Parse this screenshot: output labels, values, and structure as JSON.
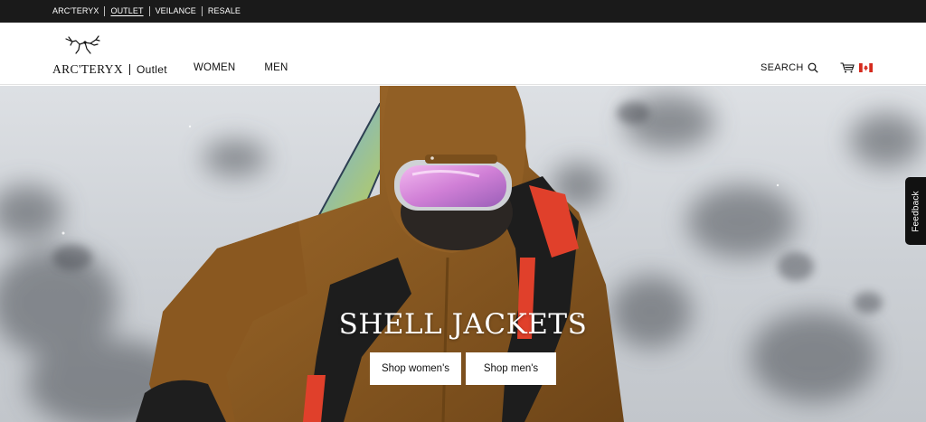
{
  "topbar": {
    "links": [
      {
        "label": "ARC'TERYX",
        "active": false
      },
      {
        "label": "OUTLET",
        "active": true
      },
      {
        "label": "VEILANCE",
        "active": false
      },
      {
        "label": "RESALE",
        "active": false
      }
    ]
  },
  "header": {
    "logo": {
      "brand": "ARC'TERYX",
      "sub": "Outlet"
    },
    "nav": [
      "WOMEN",
      "MEN"
    ],
    "search_label": "SEARCH",
    "cart_icon": "cart-icon",
    "flag_icon": "canada-flag-icon"
  },
  "hero": {
    "title": "SHELL JACKETS",
    "buttons": {
      "women": "Shop women's",
      "men": "Shop men's"
    }
  },
  "feedback": {
    "label": "Feedback"
  },
  "colors": {
    "topbar": "#1a1a1a",
    "jacket": "#8a5a22",
    "accent_red": "#e0402b",
    "goggle": "#d78bd6"
  }
}
